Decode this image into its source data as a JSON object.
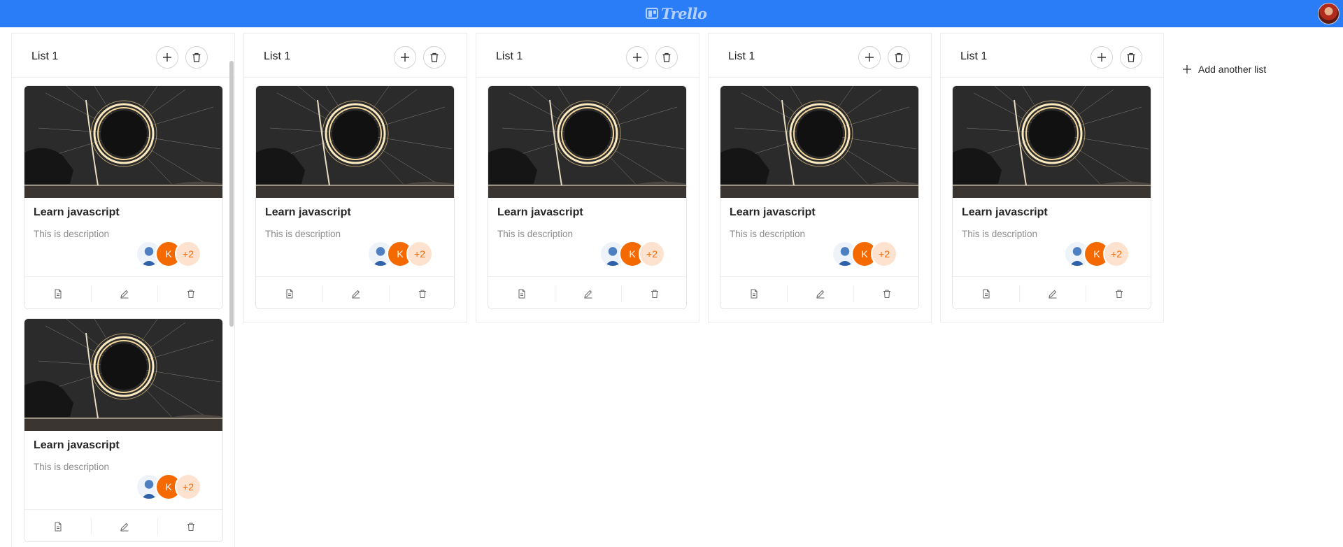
{
  "header": {
    "brand": "Trello"
  },
  "board": {
    "lists": [
      {
        "title": "List 1",
        "cards": [
          {
            "title": "Learn javascript",
            "description": "This is description",
            "member_initial": "K",
            "extra_members": "+2"
          },
          {
            "title": "Learn javascript",
            "description": "This is description",
            "member_initial": "K",
            "extra_members": "+2"
          }
        ]
      },
      {
        "title": "List 1",
        "cards": [
          {
            "title": "Learn javascript",
            "description": "This is description",
            "member_initial": "K",
            "extra_members": "+2"
          }
        ]
      },
      {
        "title": "List 1",
        "cards": [
          {
            "title": "Learn javascript",
            "description": "This is description",
            "member_initial": "K",
            "extra_members": "+2"
          }
        ]
      },
      {
        "title": "List 1",
        "cards": [
          {
            "title": "Learn javascript",
            "description": "This is description",
            "member_initial": "K",
            "extra_members": "+2"
          }
        ]
      },
      {
        "title": "List 1",
        "cards": [
          {
            "title": "Learn javascript",
            "description": "This is description",
            "member_initial": "K",
            "extra_members": "+2"
          }
        ]
      }
    ],
    "add_list_label": "Add another list"
  },
  "icons": {
    "add_card": "plus-icon",
    "delete_list": "trash-icon",
    "card_view": "file-text-icon",
    "card_edit": "edit-icon",
    "card_delete": "trash-icon",
    "add_list": "plus-icon"
  },
  "colors": {
    "topbar": "#2a7cf7",
    "avatar_orange": "#f56a00",
    "avatar_peach": "#fde3cf"
  }
}
